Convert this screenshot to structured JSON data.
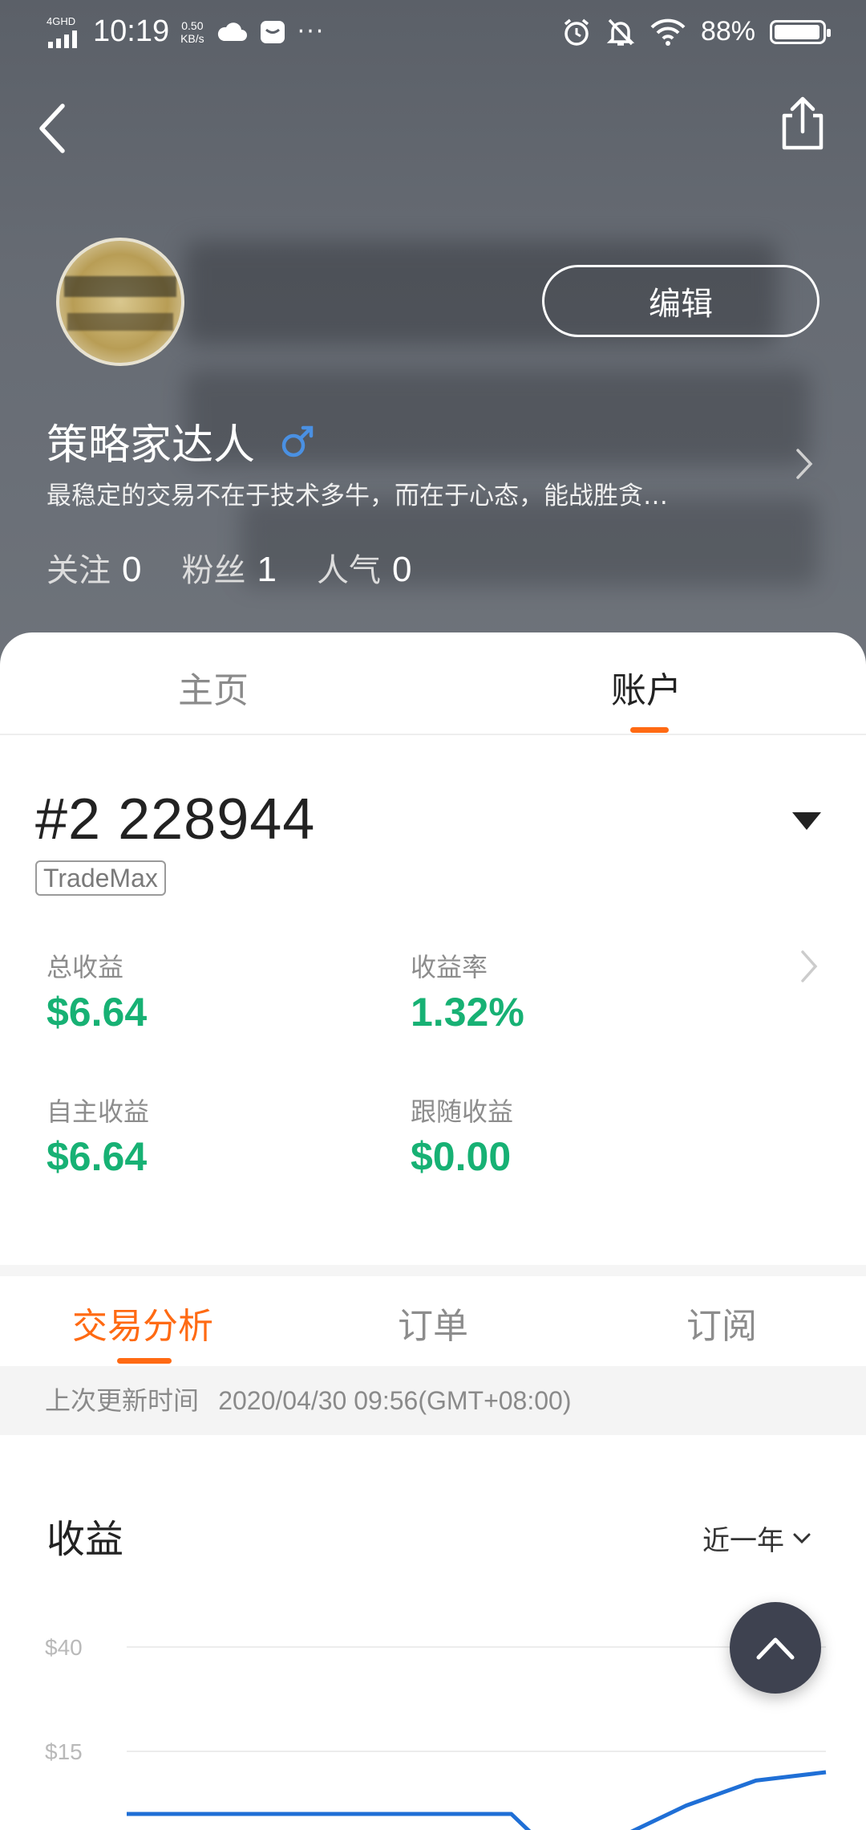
{
  "status_bar": {
    "network": "4GHD",
    "time": "10:19",
    "speed_value": "0.50",
    "speed_unit": "KB/s",
    "more": "···",
    "battery_percent": "88%",
    "battery_level": 0.88,
    "icons": [
      "signal-icon",
      "cloud-icon",
      "message-icon",
      "alarm-icon",
      "mute-bell-icon",
      "wifi-icon",
      "battery-icon"
    ]
  },
  "header": {
    "edit_label": "编辑",
    "name": "策略家达人",
    "bio": "最稳定的交易不在于技术多牛，而在于心态，能战胜贪…",
    "stats": [
      {
        "label": "关注",
        "value": "0"
      },
      {
        "label": "粉丝",
        "value": "1"
      },
      {
        "label": "人气",
        "value": "0"
      }
    ],
    "gender_color": "#4a90e2"
  },
  "tabs": {
    "home": "主页",
    "account": "账户"
  },
  "account": {
    "id": "#2 228944",
    "broker": "TradeMax",
    "metrics": [
      {
        "label": "总收益",
        "value": "$6.64"
      },
      {
        "label": "收益率",
        "value": "1.32%"
      },
      {
        "label": "自主收益",
        "value": "$6.64"
      },
      {
        "label": "跟随收益",
        "value": "$0.00"
      }
    ]
  },
  "sub_tabs": [
    "交易分析",
    "订单",
    "订阅"
  ],
  "update": {
    "label": "上次更新时间",
    "time": "2020/04/30 09:56(GMT+08:00)"
  },
  "profit": {
    "title": "收益",
    "range": "近一年"
  },
  "chart_data": {
    "type": "line",
    "title": "",
    "xlabel": "",
    "ylabel": "",
    "y_tick_labels": [
      "$40",
      "$15"
    ],
    "y_ticks": [
      40,
      15
    ],
    "ylim": [
      -10,
      40
    ],
    "x": [
      0,
      0.55,
      0.6,
      0.7,
      0.8,
      0.9,
      1.0
    ],
    "series": [
      {
        "values": [
          0,
          0,
          -8,
          -6,
          2,
          8,
          10
        ]
      }
    ],
    "grid": true
  },
  "colors": {
    "accent": "#ff6a13",
    "profit_green": "#17b174",
    "series_line": "#1f6fd6",
    "fab": "#3e4250"
  }
}
